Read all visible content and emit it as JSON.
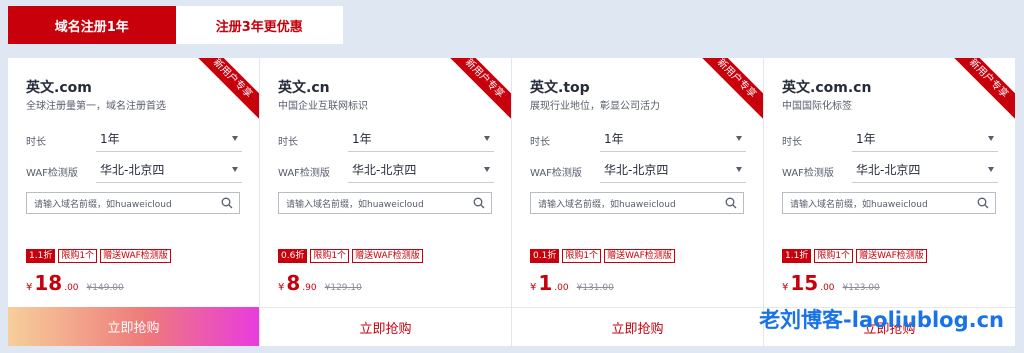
{
  "tabs": [
    {
      "label": "域名注册1年"
    },
    {
      "label": "注册3年更优惠"
    }
  ],
  "common": {
    "duration_label": "时长",
    "waf_label": "WAF检测版",
    "duration_value": "1年",
    "waf_value": "华北-北京四",
    "search_placeholder": "请输入域名前缀，如huaweicloud",
    "ribbon": "新用户专享",
    "buy_label": "立即抢购",
    "limit_tag": "限购1个",
    "gift_tag": "赠送WAF检测版",
    "currency": "¥"
  },
  "cards": [
    {
      "title": "英文.com",
      "subtitle": "全球注册量第一，域名注册首选",
      "discount": "1.1折",
      "price_int": "18",
      "price_dec": ".00",
      "orig_price": "¥149.00"
    },
    {
      "title": "英文.cn",
      "subtitle": "中国企业互联网标识",
      "discount": "0.6折",
      "price_int": "8",
      "price_dec": ".90",
      "orig_price": "¥129.10"
    },
    {
      "title": "英文.top",
      "subtitle": "展现行业地位，彰显公司活力",
      "discount": "0.1折",
      "price_int": "1",
      "price_dec": ".00",
      "orig_price": "¥131.00"
    },
    {
      "title": "英文.com.cn",
      "subtitle": "中国国际化标签",
      "discount": "1.1折",
      "price_int": "15",
      "price_dec": ".00",
      "orig_price": "¥123.00"
    }
  ],
  "watermark": "老刘博客-laoliublog.cn",
  "colors": {
    "brand_red": "#c7000b",
    "watermark_blue": "#1873e8"
  }
}
